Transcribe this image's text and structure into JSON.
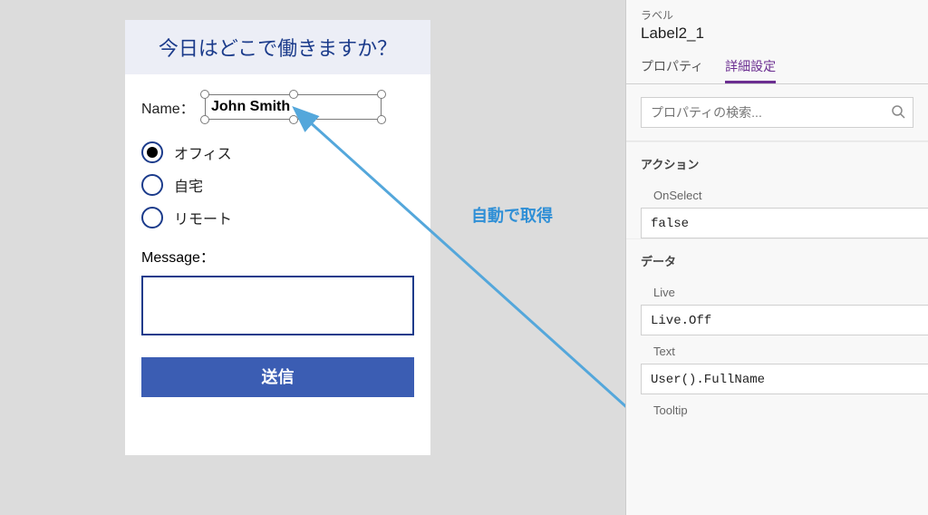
{
  "form": {
    "title": "今日はどこで働きますか？",
    "name_label": "Name：",
    "name_value": "John Smith",
    "radios": {
      "office": "オフィス",
      "home": "自宅",
      "remote": "リモート"
    },
    "message_label": "Message：",
    "submit_label": "送信"
  },
  "annotation": {
    "label": "自動で取得"
  },
  "panel": {
    "section_label": "ラベル",
    "control_name": "Label2_1",
    "tabs": {
      "properties": "プロパティ",
      "advanced": "詳細設定"
    },
    "search_placeholder": "プロパティの検索...",
    "groups": {
      "action": "アクション",
      "data": "データ"
    },
    "props": {
      "onselect_label": "OnSelect",
      "onselect_value": "false",
      "live_label": "Live",
      "live_value": "Live.Off",
      "text_label": "Text",
      "text_value": "User().FullName",
      "tooltip_label": "Tooltip"
    }
  }
}
